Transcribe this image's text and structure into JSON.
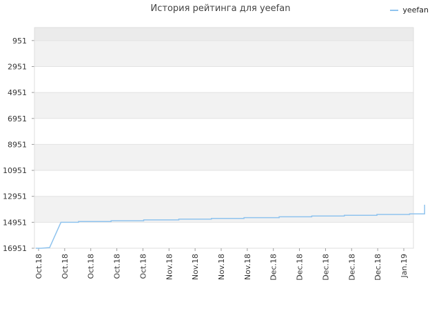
{
  "chart_data": {
    "type": "line",
    "title": "История рейтинга для yeefan",
    "legend": {
      "position": "top-right",
      "entries": [
        "yeefan"
      ]
    },
    "colors": {
      "series": "#8fc3ee",
      "band_light": "#f2f2f2",
      "band_white": "#ffffff",
      "band_top": "#ebebeb",
      "grid": "#e2e2e2"
    },
    "y_axis": {
      "ticks": [
        "951",
        "2951",
        "4951",
        "6951",
        "8951",
        "10951",
        "12951",
        "14951",
        "16951"
      ],
      "ylim": [
        16951,
        -49
      ],
      "inverted": true
    },
    "x_axis": {
      "ticks": [
        "Oct.18",
        "Oct.18",
        "Oct.18",
        "Oct.18",
        "Oct.18",
        "Nov.18",
        "Nov.18",
        "Nov.18",
        "Nov.18",
        "Dec.18",
        "Dec.18",
        "Dec.18",
        "Dec.18",
        "Dec.18",
        "Jan.19"
      ]
    },
    "series": [
      {
        "name": "yeefan",
        "points": [
          [
            0.0,
            16951
          ],
          [
            0.2,
            16951
          ],
          [
            0.55,
            16900
          ],
          [
            1.0,
            14951
          ],
          [
            1.7,
            14951
          ],
          [
            1.7,
            14890
          ],
          [
            3.0,
            14890
          ],
          [
            3.0,
            14830
          ],
          [
            4.3,
            14830
          ],
          [
            4.3,
            14770
          ],
          [
            5.7,
            14770
          ],
          [
            5.7,
            14710
          ],
          [
            7.0,
            14710
          ],
          [
            7.0,
            14650
          ],
          [
            8.3,
            14650
          ],
          [
            8.3,
            14590
          ],
          [
            9.7,
            14590
          ],
          [
            9.7,
            14530
          ],
          [
            11.0,
            14530
          ],
          [
            11.0,
            14470
          ],
          [
            12.3,
            14470
          ],
          [
            12.3,
            14410
          ],
          [
            13.6,
            14410
          ],
          [
            13.6,
            14350
          ],
          [
            14.9,
            14350
          ],
          [
            14.9,
            14300
          ],
          [
            15.5,
            14300
          ],
          [
            15.5,
            13600
          ]
        ]
      }
    ]
  }
}
